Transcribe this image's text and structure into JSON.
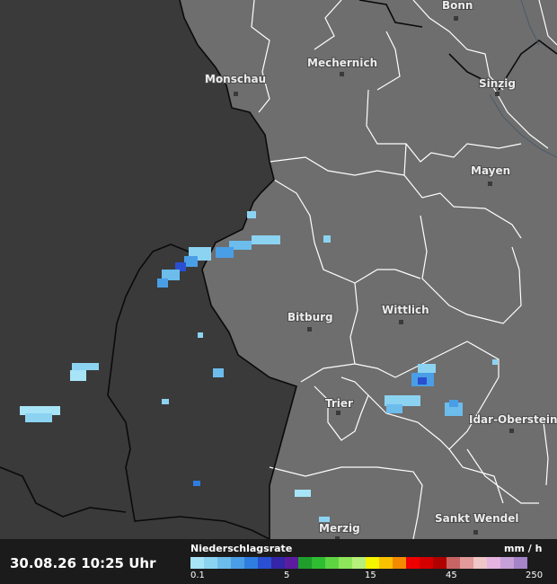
{
  "map": {
    "cities": [
      {
        "name": "Bonn"
      },
      {
        "name": "Mechernich"
      },
      {
        "name": "Monschau"
      },
      {
        "name": "Sinzig"
      },
      {
        "name": "Mayen"
      },
      {
        "name": "Bitburg"
      },
      {
        "name": "Wittlich"
      },
      {
        "name": "Trier"
      },
      {
        "name": "Idar-Oberstein"
      },
      {
        "name": "Merzig"
      },
      {
        "name": "Sankt Wendel"
      }
    ],
    "colors": {
      "outside_region": "#3a3a3a",
      "inside_region": "#6e6e6e",
      "border": "#ffffff",
      "country_border": "#000000"
    }
  },
  "footer": {
    "timestamp": "30.08.26 10:25 Uhr",
    "legend": {
      "title": "Niederschlagsrate",
      "unit": "mm / h",
      "ticks": [
        "0.1",
        "5",
        "15",
        "45",
        "250"
      ],
      "colors": [
        "#a7e4f7",
        "#8cd3f2",
        "#6cbcec",
        "#4a9ee6",
        "#2f7de0",
        "#2a4fd1",
        "#3525a8",
        "#5b1d9e",
        "#1f9e2c",
        "#2fbd32",
        "#5fd442",
        "#8ee65a",
        "#b7f07a",
        "#f7f400",
        "#f9c200",
        "#f38a00",
        "#ee0000",
        "#d40000",
        "#b00000",
        "#c86464",
        "#e29a9a",
        "#f0c6c6",
        "#e6b4e0",
        "#c8a0d8",
        "#a684c8"
      ]
    }
  }
}
